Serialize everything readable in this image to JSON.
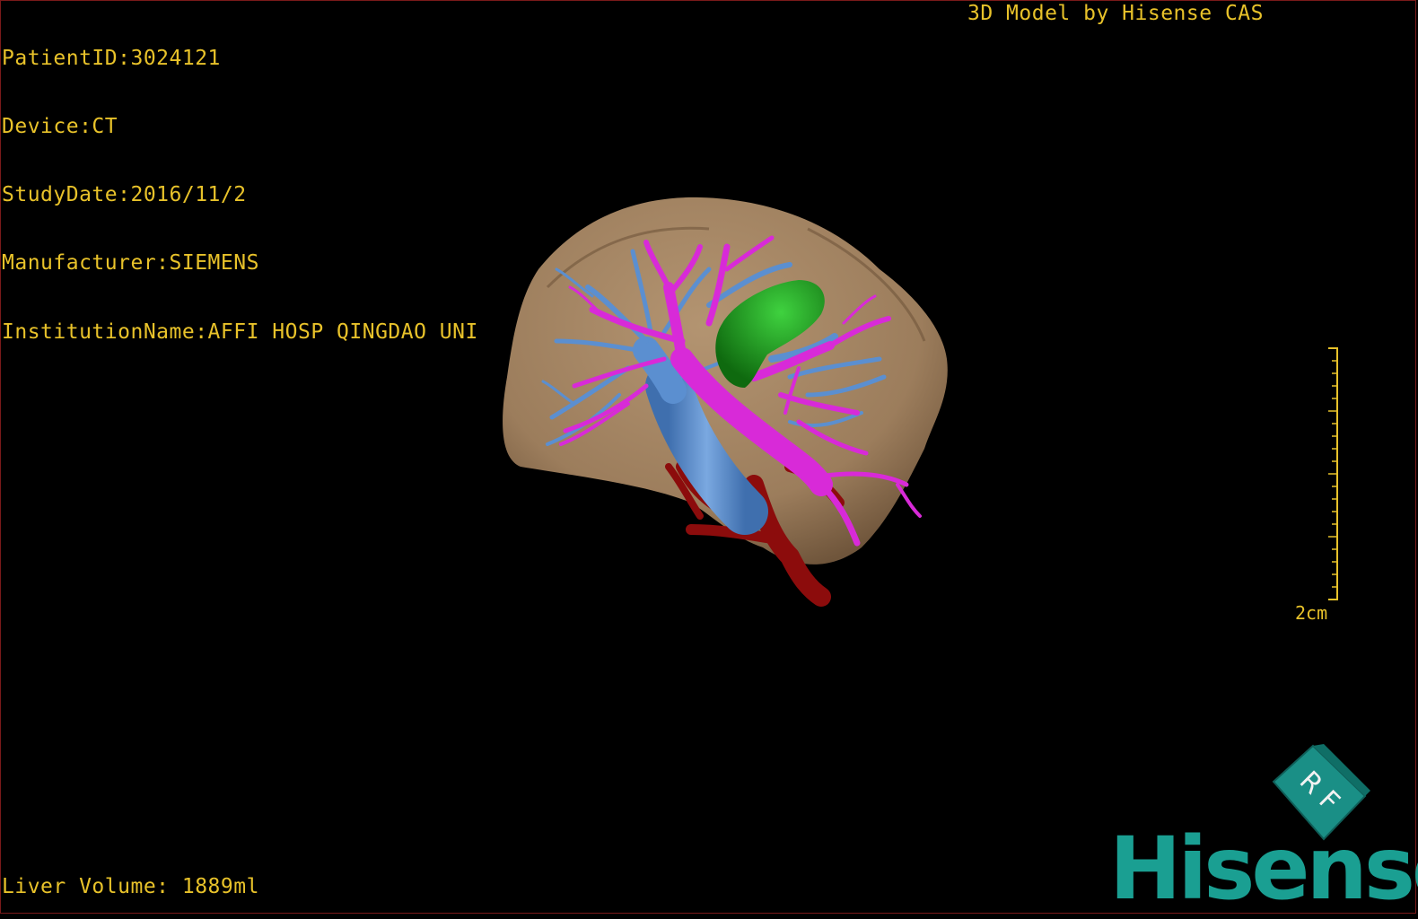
{
  "overlay": {
    "patient_id": "PatientID:3024121",
    "device": "Device:CT",
    "study_date": "StudyDate:2016/11/2",
    "manufacturer": "Manufacturer:SIEMENS",
    "institution": "InstitutionName:AFFI HOSP QINGDAO UNI",
    "model_credit": "3D Model by Hisense CAS",
    "liver_volume": "Liver Volume: 1889ml"
  },
  "scale_bar": {
    "label": "2cm"
  },
  "orientation_cube": {
    "face_letters": "R F"
  },
  "logo": {
    "text": "Hisense"
  },
  "colors": {
    "text": "#e8c22a",
    "liver": "#9c7d5c",
    "portal_vein": "#d82ad8",
    "hepatic_vein": "#5b8fd0",
    "artery": "#8c0c0c",
    "tumor": "#1f9e1f",
    "brand": "#1a9f92"
  }
}
